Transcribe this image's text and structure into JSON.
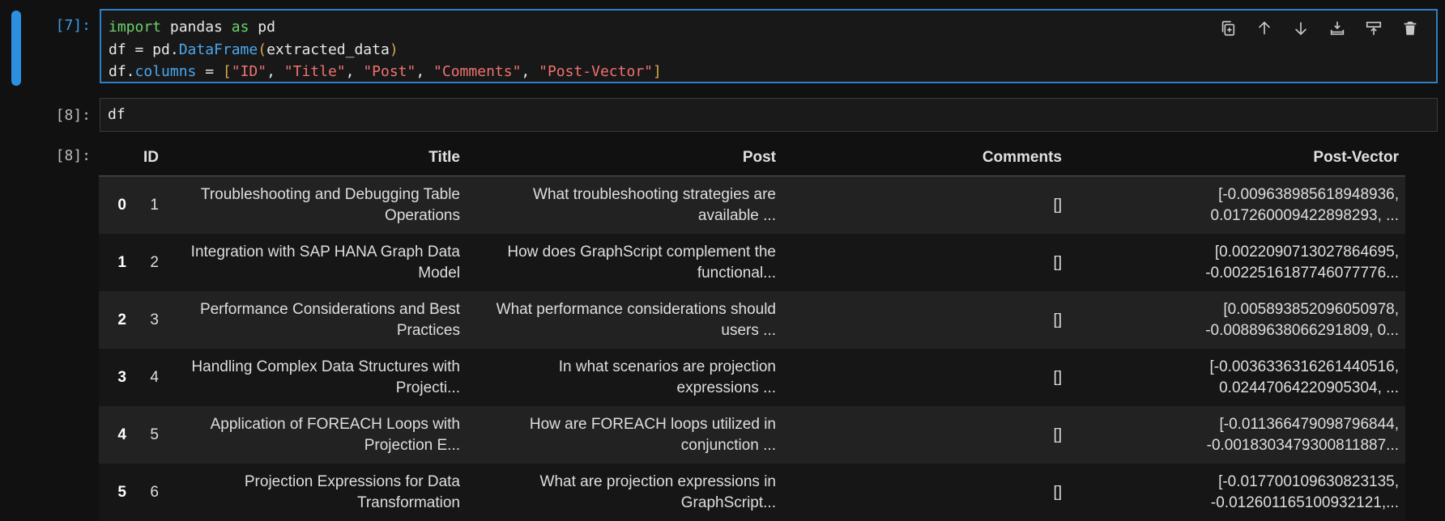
{
  "cell1": {
    "prompt": "[7]:",
    "code": {
      "line1": {
        "kw": "import",
        "mod": " pandas ",
        "as": "as",
        "alias": " pd"
      },
      "line2": {
        "var": "df = pd.",
        "attr": "DataFrame",
        "open": "(",
        "arg": "extracted_data",
        "close": ")"
      },
      "line3": {
        "var": "df.",
        "attr": "columns",
        "eq": " = ",
        "lb": "[",
        "s1": "\"ID\"",
        "c1": ", ",
        "s2": "\"Title\"",
        "c2": ", ",
        "s3": "\"Post\"",
        "c3": ", ",
        "s4": "\"Comments\"",
        "c4": ", ",
        "s5": "\"Post-Vector\"",
        "rb": "]"
      }
    }
  },
  "toolbar": {
    "icons": [
      "copy-icon",
      "arrow-up-icon",
      "arrow-down-icon",
      "insert-below-icon",
      "insert-above-icon",
      "trash-icon"
    ]
  },
  "cell2": {
    "prompt": "[8]:",
    "code": "df",
    "out_prompt": "[8]:"
  },
  "table": {
    "columns": [
      "",
      "ID",
      "Title",
      "Post",
      "Comments",
      "Post-Vector"
    ],
    "rows": [
      {
        "idx": "0",
        "id": "1",
        "title1": "Troubleshooting and Debugging Table",
        "title2": "Operations",
        "post1": "What troubleshooting strategies are",
        "post2": "available ...",
        "comments": "[]",
        "vec1": "[-0.009638985618948936,",
        "vec2": "0.017260009422898293, ..."
      },
      {
        "idx": "1",
        "id": "2",
        "title1": "Integration with SAP HANA Graph Data",
        "title2": "Model",
        "post1": "How does GraphScript complement the",
        "post2": "functional...",
        "comments": "[]",
        "vec1": "[0.0022090713027864695,",
        "vec2": "-0.0022516187746077776..."
      },
      {
        "idx": "2",
        "id": "3",
        "title1": "Performance Considerations and Best",
        "title2": "Practices",
        "post1": "What performance considerations should",
        "post2": "users ...",
        "comments": "[]",
        "vec1": "[0.005893852096050978,",
        "vec2": "-0.00889638066291809, 0..."
      },
      {
        "idx": "3",
        "id": "4",
        "title1": "Handling Complex Data Structures with",
        "title2": "Projecti...",
        "post1": "In what scenarios are projection",
        "post2": "expressions ...",
        "comments": "[]",
        "vec1": "[-0.0036336316261440516,",
        "vec2": "0.02447064220905304, ..."
      },
      {
        "idx": "4",
        "id": "5",
        "title1": "Application of FOREACH Loops with",
        "title2": "Projection E...",
        "post1": "How are FOREACH loops utilized in",
        "post2": "conjunction ...",
        "comments": "[]",
        "vec1": "[-0.011366479098796844,",
        "vec2": "-0.0018303479300811887..."
      },
      {
        "idx": "5",
        "id": "6",
        "title1": "Projection Expressions for Data",
        "title2": "Transformation",
        "post1": "What are projection expressions in",
        "post2": "GraphScript...",
        "comments": "[]",
        "vec1": "[-0.017700109630823135,",
        "vec2": "-0.012601165100932121,..."
      }
    ]
  }
}
